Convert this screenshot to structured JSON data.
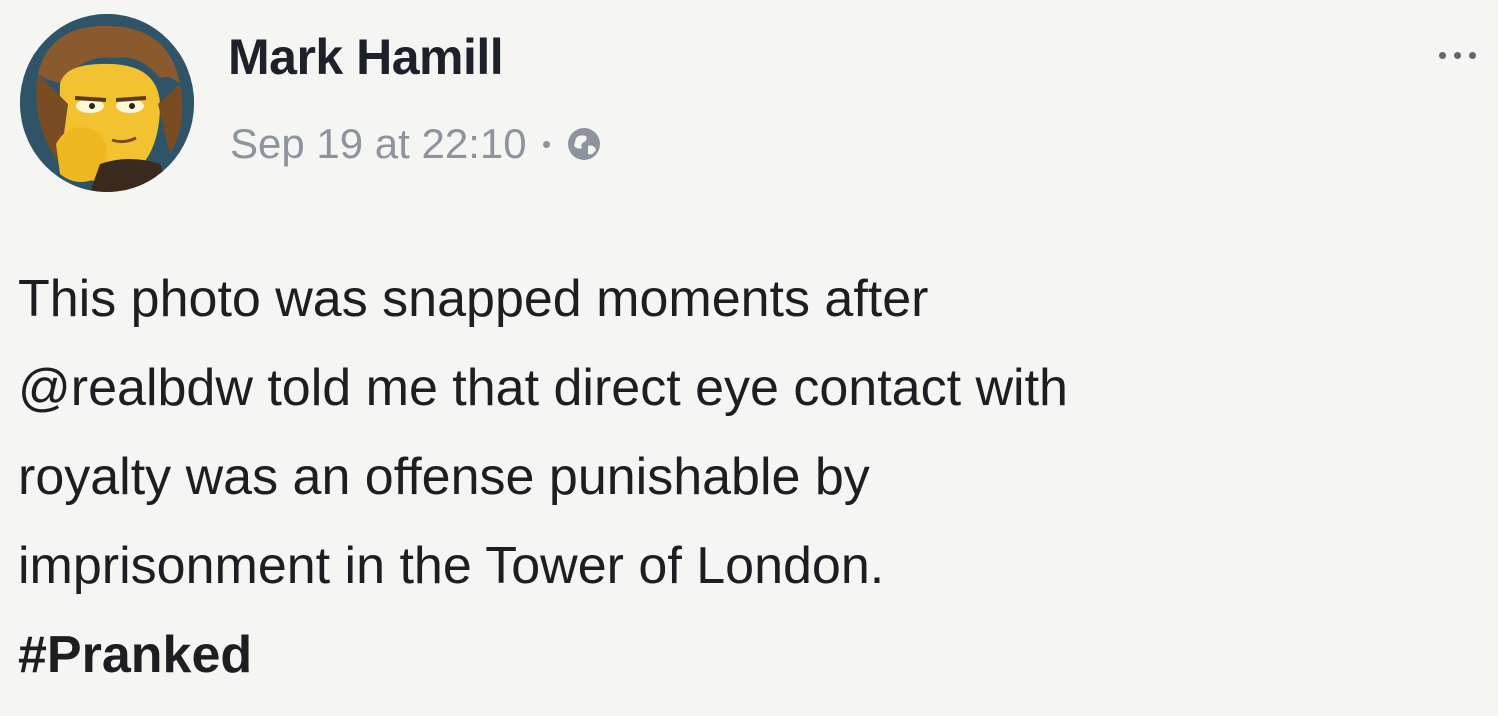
{
  "post": {
    "author": "Mark Hamill",
    "timestamp": "Sep 19 at 22:10",
    "privacy_icon": "globe-icon",
    "menu_icon": "more-options-icon",
    "avatar_icon": "profile-avatar-icon",
    "body_lines": [
      "This photo was snapped moments after",
      "@realbdw told me that direct eye contact with",
      "royalty was an offense punishable by",
      "imprisonment in the Tower of London."
    ],
    "hashtag": "#Pranked"
  },
  "colors": {
    "background": "#f5f5f3",
    "text": "#1c1e21",
    "meta": "#8d949e"
  }
}
